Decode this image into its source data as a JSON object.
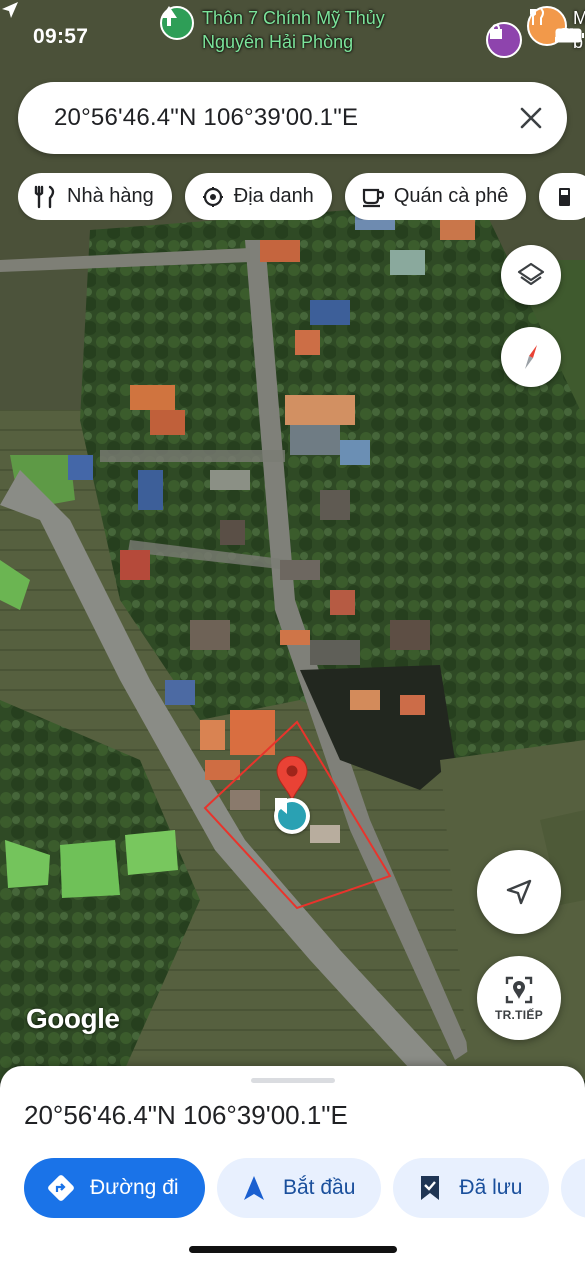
{
  "status_bar": {
    "time": "09:57"
  },
  "map": {
    "place_label": {
      "line1": "Thôn 7 Chính Mỹ Thủy",
      "line2": "Nguyên Hải Phòng"
    },
    "corner_label_line1": "M",
    "corner_label_line2": "b",
    "attribution": "Google"
  },
  "search": {
    "query": "20°56'46.4\"N 106°39'00.1\"E"
  },
  "chips": [
    {
      "label": "Nhà hàng",
      "icon": "fork-knife-icon"
    },
    {
      "label": "Địa danh",
      "icon": "landmark-icon"
    },
    {
      "label": "Quán cà phê",
      "icon": "coffee-cup-icon"
    },
    {
      "label": "",
      "icon": "gas-station-icon"
    }
  ],
  "controls": {
    "recenter_label": "TR.TIẾP"
  },
  "sheet": {
    "title": "20°56'46.4\"N 106°39'00.1\"E",
    "actions": [
      {
        "label": "Đường đi",
        "icon": "directions-icon"
      },
      {
        "label": "Bắt đầu",
        "icon": "navigation-arrow-icon"
      },
      {
        "label": "Đã lưu",
        "icon": "bookmark-icon"
      }
    ]
  },
  "colors": {
    "accent": "#1a73e8",
    "pin": "#e94235",
    "boundary": "#e8342c",
    "secondary_bg": "#e8f0fe"
  }
}
